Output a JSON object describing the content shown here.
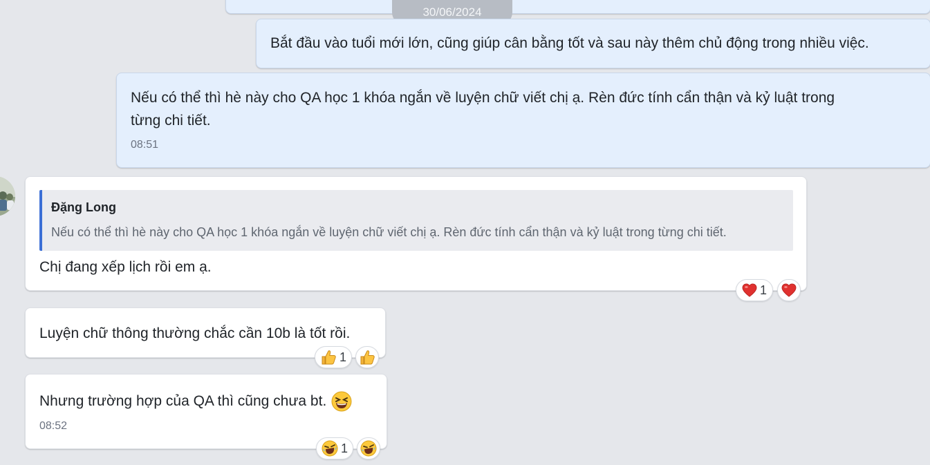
{
  "date_divider": "30/06/2024",
  "messages": [
    {
      "id": "out-1",
      "text": "Bắt đầu vào tuổi mới lớn, cũng giúp cân bằng tốt và sau này thêm chủ động trong nhiều việc."
    },
    {
      "id": "out-2",
      "text_line1": "Nếu có thể thì hè này cho QA học 1 khóa ngắn về luyện chữ viết chị ạ. Rèn đức tính cẩn thận và kỷ luật trong",
      "text_line2": "từng chi tiết.",
      "time": "08:51"
    },
    {
      "id": "in-1",
      "quote": {
        "author": "Đặng Long",
        "text": "Nếu có thể thì hè này cho QA học 1 khóa ngắn về luyện chữ viết chị ạ. Rèn đức tính cẩn thận và kỷ luật trong từng chi tiết."
      },
      "text": "Chị đang xếp lịch rồi em ạ.",
      "reaction": {
        "emoji": "heart-icon",
        "count": "1"
      }
    },
    {
      "id": "in-2",
      "text": "Luyện chữ thông thường chắc cần 10b là tốt rồi.",
      "reaction": {
        "emoji": "thumbs-up-icon",
        "count": "1"
      }
    },
    {
      "id": "in-3",
      "text": "Nhưng trường hợp của QA thì cũng chưa bt.",
      "inline_emoji": "grinning-squint-icon",
      "time": "08:52",
      "reaction": {
        "emoji": "laughing-crying-icon",
        "count": "1"
      }
    }
  ],
  "colors": {
    "background": "#e5e7eb",
    "outgoing_bubble": "#e4effd",
    "incoming_bubble": "#ffffff",
    "quote_accent": "#3b6fd6",
    "date_pill": "#b7bcc4"
  }
}
